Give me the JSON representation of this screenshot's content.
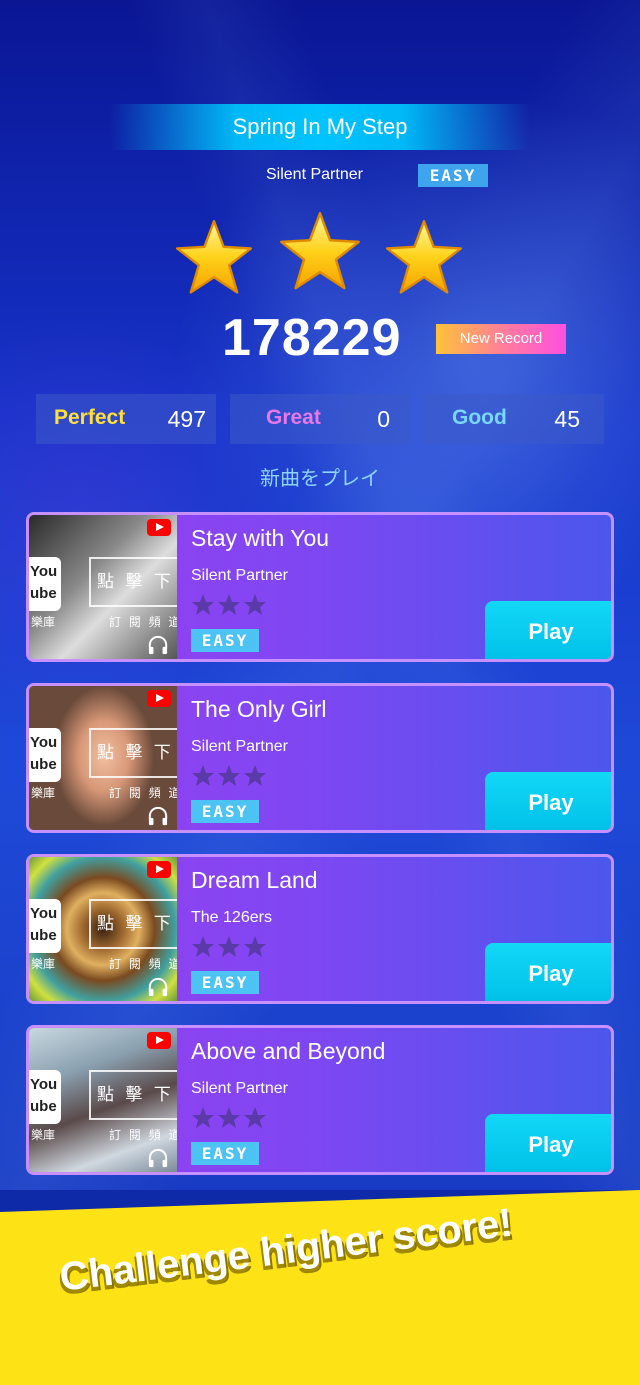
{
  "song": {
    "title": "Spring In My Step",
    "artist": "Silent Partner",
    "difficulty": "EASY",
    "stars_earned": 3,
    "score": "178229",
    "record_label": "New Record"
  },
  "stats": [
    {
      "label": "Perfect",
      "value": "497",
      "color": "#ffe03a"
    },
    {
      "label": "Great",
      "value": "0",
      "color": "#e877e8"
    },
    {
      "label": "Good",
      "value": "45",
      "color": "#78d6ff"
    }
  ],
  "new_songs_label": "新曲をプレイ",
  "songs": [
    {
      "title": "Stay with You",
      "artist": "Silent Partner",
      "difficulty": "EASY",
      "play": "Play",
      "stars": 3,
      "thumb": {
        "yt_text": "You\nube",
        "overlay": "點 擊 下 載",
        "sub_left": "樂庫",
        "sub_right": "訂 閱 頻 道"
      }
    },
    {
      "title": "The Only Girl",
      "artist": "Silent Partner",
      "difficulty": "EASY",
      "play": "Play",
      "stars": 3,
      "thumb": {
        "yt_text": "You\nube",
        "overlay": "點 擊 下 載",
        "sub_left": "樂庫",
        "sub_right": "訂 閱 頻 道"
      }
    },
    {
      "title": "Dream Land",
      "artist": "The 126ers",
      "difficulty": "EASY",
      "play": "Play",
      "stars": 3,
      "thumb": {
        "yt_text": "You\nube",
        "overlay": "點 擊 下 載",
        "sub_left": "樂庫",
        "sub_right": "訂 閱 頻 道"
      }
    },
    {
      "title": "Above and Beyond",
      "artist": "Silent Partner",
      "difficulty": "EASY",
      "play": "Play",
      "stars": 3,
      "thumb": {
        "yt_text": "You\nube",
        "overlay": "點 擊 下 載",
        "sub_left": "樂庫",
        "sub_right": "訂 閱 頻 道"
      }
    }
  ],
  "cta": "Challenge higher score!",
  "colors": {
    "card_border": "#c790ff",
    "play_button": "#00bfe8",
    "easy_badge": "#4cc3f3",
    "promo_background": "#fde315"
  }
}
